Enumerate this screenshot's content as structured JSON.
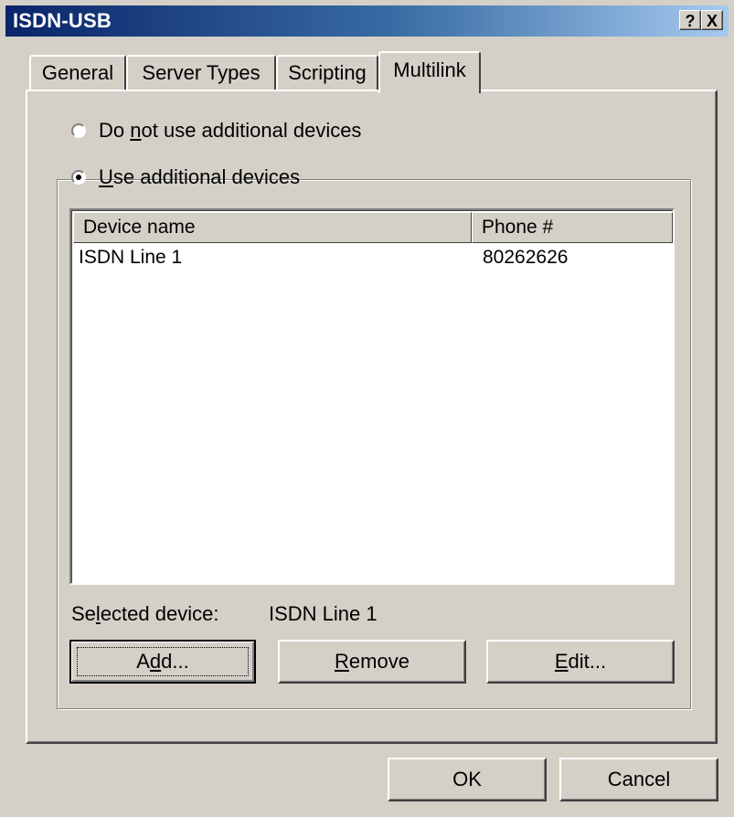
{
  "window": {
    "title": "ISDN-USB",
    "help_button": "?",
    "close_button": "X"
  },
  "tabs": [
    {
      "label": "General",
      "active": false
    },
    {
      "label": "Server Types",
      "active": false
    },
    {
      "label": "Scripting",
      "active": false
    },
    {
      "label": "Multilink",
      "active": true
    }
  ],
  "multilink": {
    "option_no_additional": {
      "pre": "Do ",
      "mnemonic": "n",
      "post": "ot use additional devices",
      "checked": false
    },
    "option_use_additional": {
      "pre": "",
      "mnemonic": "U",
      "post": "se additional devices",
      "checked": true
    },
    "list": {
      "columns": [
        "Device name",
        "Phone #"
      ],
      "rows": [
        {
          "device": "ISDN Line 1",
          "phone": "80262626"
        }
      ]
    },
    "selected_device": {
      "label_pre": "Se",
      "label_mnemonic": "l",
      "label_post": "ected device:",
      "value": "ISDN Line 1"
    },
    "buttons": {
      "add": {
        "pre": "A",
        "mnemonic": "d",
        "post": "d..."
      },
      "remove": {
        "pre": "",
        "mnemonic": "R",
        "post": "emove"
      },
      "edit": {
        "pre": "",
        "mnemonic": "E",
        "post": "dit..."
      }
    }
  },
  "footer": {
    "ok_label": "OK",
    "cancel_label": "Cancel"
  }
}
